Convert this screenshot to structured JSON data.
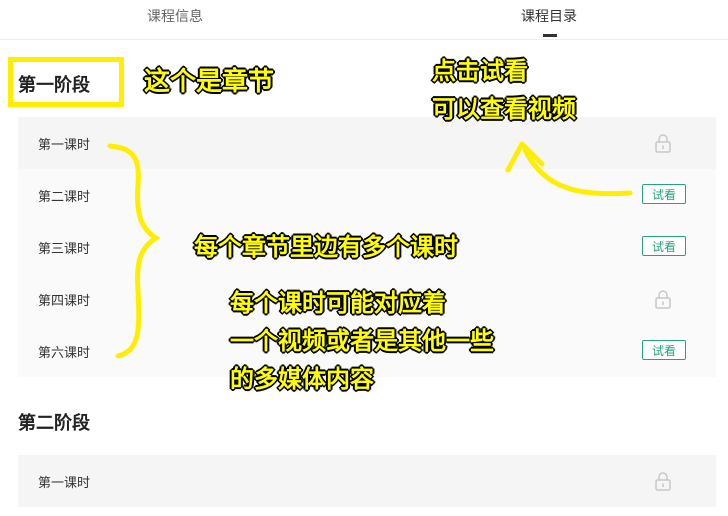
{
  "tabs": [
    {
      "label": "课程信息",
      "active": false
    },
    {
      "label": "课程目录",
      "active": true
    }
  ],
  "sections": [
    {
      "title": "第一阶段",
      "lessons": [
        {
          "title": "第一课时",
          "action": "lock-icon"
        },
        {
          "title": "第二课时",
          "action": "试看"
        },
        {
          "title": "第三课时",
          "action": "试看"
        },
        {
          "title": "第四课时",
          "action": "lock-icon"
        },
        {
          "title": "第六课时",
          "action": "试看"
        }
      ]
    },
    {
      "title": "第二阶段",
      "lessons": [
        {
          "title": "第一课时",
          "action": "lock-icon"
        }
      ]
    }
  ],
  "annotations": {
    "chapter_note": "这个是章节",
    "trial_note_line1": "点击试看",
    "trial_note_line2": "可以查看视频",
    "lessons_note": "每个章节里边有多个课时",
    "media_note_line1": "每个课时可能对应着",
    "media_note_line2": "一个视频或者是其他一些",
    "media_note_line3": "的多媒体内容"
  },
  "colors": {
    "accent_green": "#27a37a",
    "annotation_yellow": "#ffff00",
    "highlight_box": "#ffee00"
  }
}
